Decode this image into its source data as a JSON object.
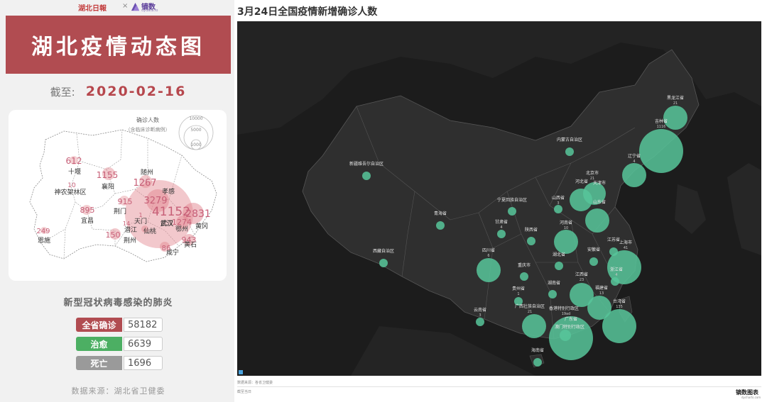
{
  "logos": {
    "left": "湖北日報",
    "separator": "×",
    "right": "镝数",
    "right_sub": "dydata.io"
  },
  "left_panel": {
    "title": "湖北疫情动态图",
    "date_prefix": "截至:",
    "date": "2020-02-16",
    "legend": {
      "title": "确诊人数",
      "subtitle": "（含临床诊断病例）",
      "sizes": [
        "10000",
        "5000",
        "1000"
      ]
    },
    "subtitle": "新型冠状病毒感染的肺炎",
    "stats": [
      {
        "label": "全省确诊",
        "value": "58182",
        "color": "#b14c51"
      },
      {
        "label": "治愈",
        "value": "6639",
        "color": "#4caf63"
      },
      {
        "label": "死亡",
        "value": "1696",
        "color": "#9a9a9a"
      }
    ],
    "source": "数据来源：湖北省卫健委"
  },
  "hubei_map": {
    "cities": [
      {
        "name": "十堰",
        "value": "612"
      },
      {
        "name": "神农架林区",
        "value": "10"
      },
      {
        "name": "襄阳",
        "value": "1155"
      },
      {
        "name": "随州",
        "value": "1267"
      },
      {
        "name": "孝感",
        "value": "3279"
      },
      {
        "name": "宜昌",
        "value": "895"
      },
      {
        "name": "荆门",
        "value": "915"
      },
      {
        "name": "武汉",
        "value": "41152"
      },
      {
        "name": "黄冈",
        "value": "2831"
      },
      {
        "name": "天门",
        "value": ""
      },
      {
        "name": "潜江",
        "value": ""
      },
      {
        "name": "仙桃",
        "value": ""
      },
      {
        "name": "鄂州",
        "value": "1274"
      },
      {
        "name": "荆州",
        "value": "150"
      },
      {
        "name": "恩施",
        "value": "249"
      },
      {
        "name": "黄石",
        "value": "943"
      },
      {
        "name": "咸宁",
        "value": ""
      }
    ],
    "fragments": [
      "14",
      "1",
      "86"
    ]
  },
  "right_panel": {
    "title": "3月24日全国疫情新增确诊人数",
    "credit": "数据来源：各省卫健委",
    "credit2": "截至当日",
    "brand": "镝数图表",
    "brand_sub": "dycharts.com",
    "provinces": [
      {
        "name": "黑龙江省",
        "value": "21"
      },
      {
        "name": "吉林省",
        "value": "1116"
      },
      {
        "name": "辽宁省",
        "value": "4"
      },
      {
        "name": "内蒙古自治区",
        "value": ""
      },
      {
        "name": "新疆维吾尔自治区",
        "value": ""
      },
      {
        "name": "北京市",
        "value": "21"
      },
      {
        "name": "天津市",
        "value": ""
      },
      {
        "name": "河北省",
        "value": ""
      },
      {
        "name": "山西省",
        "value": "3"
      },
      {
        "name": "山东省",
        "value": ""
      },
      {
        "name": "宁夏回族自治区",
        "value": ""
      },
      {
        "name": "青海省",
        "value": ""
      },
      {
        "name": "甘肃省",
        "value": "4"
      },
      {
        "name": "陕西省",
        "value": ""
      },
      {
        "name": "河南省",
        "value": "10"
      },
      {
        "name": "江苏省",
        "value": ""
      },
      {
        "name": "上海市",
        "value": "41"
      },
      {
        "name": "安徽省",
        "value": ""
      },
      {
        "name": "四川省",
        "value": "6"
      },
      {
        "name": "湖北省",
        "value": ""
      },
      {
        "name": "浙江省",
        "value": "4"
      },
      {
        "name": "西藏自治区",
        "value": ""
      },
      {
        "name": "重庆市",
        "value": ""
      },
      {
        "name": "江西省",
        "value": "23"
      },
      {
        "name": "湖南省",
        "value": ""
      },
      {
        "name": "福建省",
        "value": "13"
      },
      {
        "name": "贵州省",
        "value": "1"
      },
      {
        "name": "台湾省",
        "value": "135"
      },
      {
        "name": "广西壮族自治区",
        "value": "21"
      },
      {
        "name": "云南省",
        "value": "3"
      },
      {
        "name": "香港特别行政区",
        "value": "19ad"
      },
      {
        "name": "澳门特别行政区",
        "value": ""
      },
      {
        "name": "广东省",
        "value": ""
      },
      {
        "name": "海南省",
        "value": ""
      }
    ]
  },
  "colors": {
    "title_red": "#b14c51",
    "hubei_bubble": "#e2868f",
    "dark_bg": "#1c1c1c",
    "land": "#2a2a2a",
    "bubble": "#57c59a",
    "cured_green": "#4caf63",
    "death_gray": "#9a9a9a"
  }
}
